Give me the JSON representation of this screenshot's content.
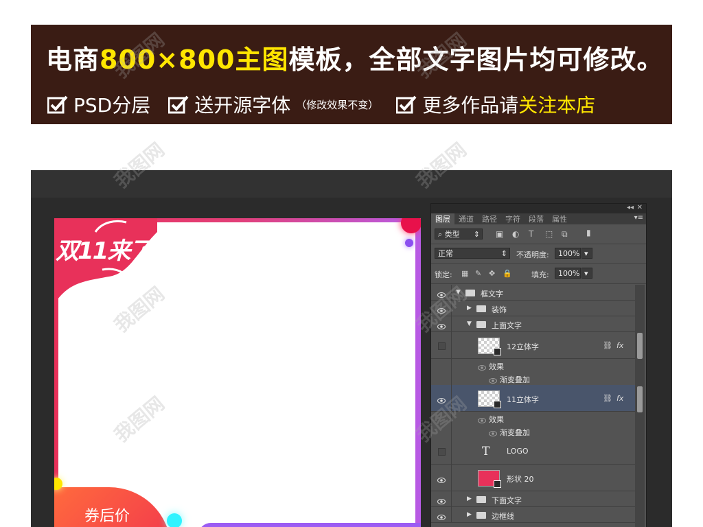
{
  "banner": {
    "line1_pre": "电商",
    "line1_hl": "800×800主图",
    "line1_post": "模板，全部文字图片均可修改。",
    "item1": "PSD分层",
    "item2": "送开源字体",
    "item2_note": "（修改效果不变）",
    "item3_pre": "更多作品请",
    "item3_hl": "关注本店"
  },
  "colors": {
    "banner_bg": "#3a1c14",
    "highlight": "#ffe600",
    "canvas_red": "#e8315a",
    "canvas_purple": "#9b5cf3",
    "selected_layer": "#49556b"
  },
  "canvas": {
    "logo_text": "双11来了",
    "price_label": "券后价"
  },
  "panel": {
    "tabs": [
      "图层",
      "通道",
      "路径",
      "字符",
      "段落",
      "属性"
    ],
    "filter_label": "类型",
    "blend_mode": "正常",
    "opacity_label": "不透明度:",
    "opacity_value": "100%",
    "lock_label": "锁定:",
    "fill_label": "填充:",
    "fill_value": "100%",
    "layers": [
      {
        "name": "框文字",
        "kind": "group-open",
        "indent": 0,
        "visible": true
      },
      {
        "name": "装饰",
        "kind": "group-closed",
        "indent": 1,
        "visible": true
      },
      {
        "name": "上面文字",
        "kind": "group-open",
        "indent": 1,
        "visible": true
      },
      {
        "name": "12立体字",
        "kind": "smart",
        "indent": 2,
        "visible": false
      },
      {
        "name": "效果",
        "kind": "effect",
        "indent": 3
      },
      {
        "name": "渐变叠加",
        "kind": "effect-item",
        "indent": 4
      },
      {
        "name": "11立体字",
        "kind": "smart",
        "indent": 2,
        "visible": true,
        "selected": true
      },
      {
        "name": "效果",
        "kind": "effect",
        "indent": 3
      },
      {
        "name": "渐变叠加",
        "kind": "effect-item",
        "indent": 4
      },
      {
        "name": "LOGO",
        "kind": "text",
        "indent": 2,
        "visible": false
      },
      {
        "name": "形状 20",
        "kind": "shape",
        "indent": 2,
        "visible": true
      },
      {
        "name": "下面文字",
        "kind": "group-closed",
        "indent": 1,
        "visible": true
      },
      {
        "name": "边框线",
        "kind": "group-closed",
        "indent": 1,
        "visible": true
      }
    ]
  },
  "watermark": "我图网"
}
